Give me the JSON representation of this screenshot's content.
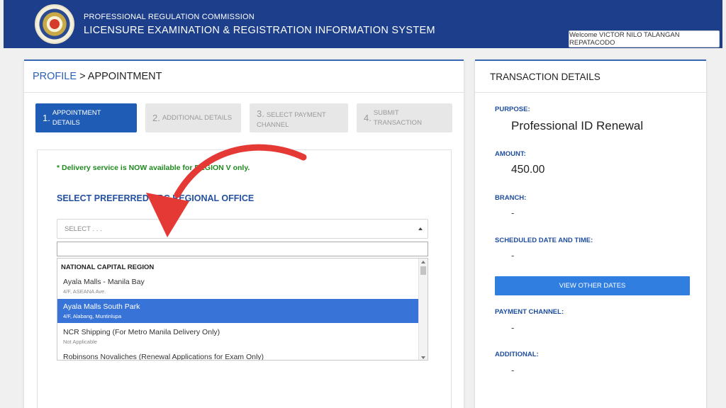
{
  "header": {
    "line1": "PROFESSIONAL REGULATION COMMISSION",
    "line2": "LICENSURE EXAMINATION & REGISTRATION INFORMATION SYSTEM",
    "welcome": "Welcome VICTOR NILO TALANGAN REPATACODO"
  },
  "breadcrumb": {
    "link": "PROFILE",
    "separator": " > ",
    "current": "APPOINTMENT"
  },
  "steps": [
    {
      "num": "1.",
      "label": "APPOINTMENT DETAILS"
    },
    {
      "num": "2.",
      "label": "ADDITIONAL DETAILS"
    },
    {
      "num": "3.",
      "label": "SELECT PAYMENT CHANNEL"
    },
    {
      "num": "4.",
      "label": "SUBMIT TRANSACTION"
    }
  ],
  "form": {
    "delivery_note": "* Delivery service is NOW available for REGION V only.",
    "section_title": "SELECT PREFERRED PRC REGIONAL OFFICE",
    "select_value": "SELECT . . .",
    "search_value": ""
  },
  "dropdown": {
    "group": "NATIONAL CAPITAL REGION",
    "options": [
      {
        "name": "Ayala Malls - Manila Bay",
        "sub": "4/F, ASEANA Ave."
      },
      {
        "name": "Ayala Malls South Park",
        "sub": "4/F, Alabang, Muntinlupa"
      },
      {
        "name": "NCR Shipping (For Metro Manila Delivery Only)",
        "sub": "Not Applicable"
      },
      {
        "name": "Robinsons Novaliches (Renewal Applications for Exam Only)",
        "sub": ""
      }
    ]
  },
  "transaction": {
    "title": "TRANSACTION DETAILS",
    "purpose_label": "PURPOSE:",
    "purpose_value": "Professional ID Renewal",
    "amount_label": "AMOUNT:",
    "amount_value": "450.00",
    "branch_label": "BRANCH:",
    "branch_value": "-",
    "schedule_label": "SCHEDULED DATE AND TIME:",
    "schedule_value": "-",
    "view_dates_label": "VIEW OTHER DATES",
    "payment_label": "PAYMENT CHANNEL:",
    "payment_value": "-",
    "additional_label": "ADDITIONAL:",
    "additional_value": "-"
  },
  "colors": {
    "header_bg": "#1d3f8b",
    "active_step": "#1e5cb5",
    "selected_option": "#3874d8",
    "annotation_arrow": "#e53935",
    "button": "#2f7ee0"
  }
}
